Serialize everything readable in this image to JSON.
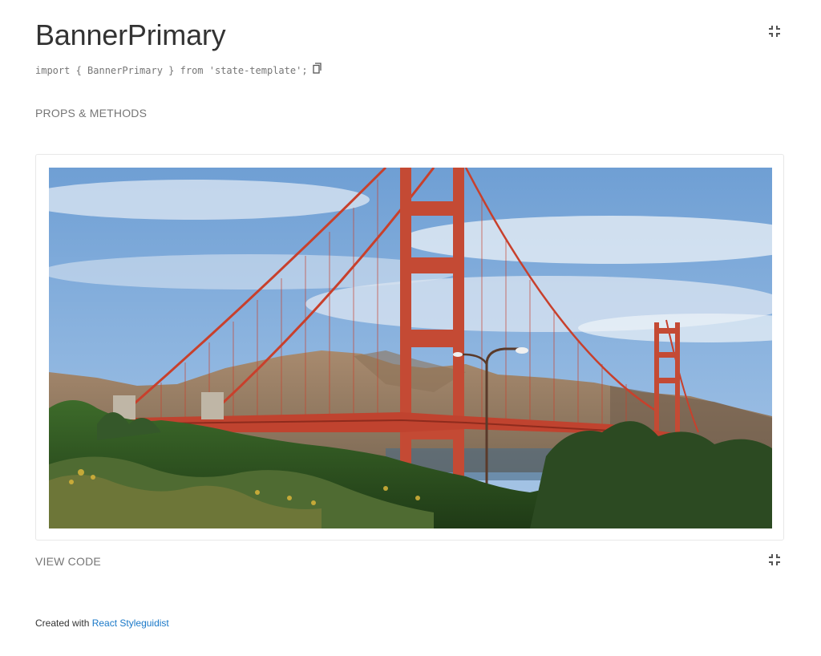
{
  "component": {
    "title": "BannerPrimary",
    "import_statement": "import { BannerPrimary } from 'state-template';",
    "copy_icon": "copy-icon",
    "isolate_icon": "minimize-icon"
  },
  "links": {
    "props_methods": "PROPS & METHODS",
    "view_code": "VIEW CODE"
  },
  "banner": {
    "image_subject": "Golden Gate Bridge"
  },
  "footer": {
    "prefix": "Created with",
    "link_label": "React Styleguidist"
  },
  "colors": {
    "text": "#333333",
    "muted": "#767676",
    "link": "#1978c8",
    "bridge": "#c8402c"
  }
}
